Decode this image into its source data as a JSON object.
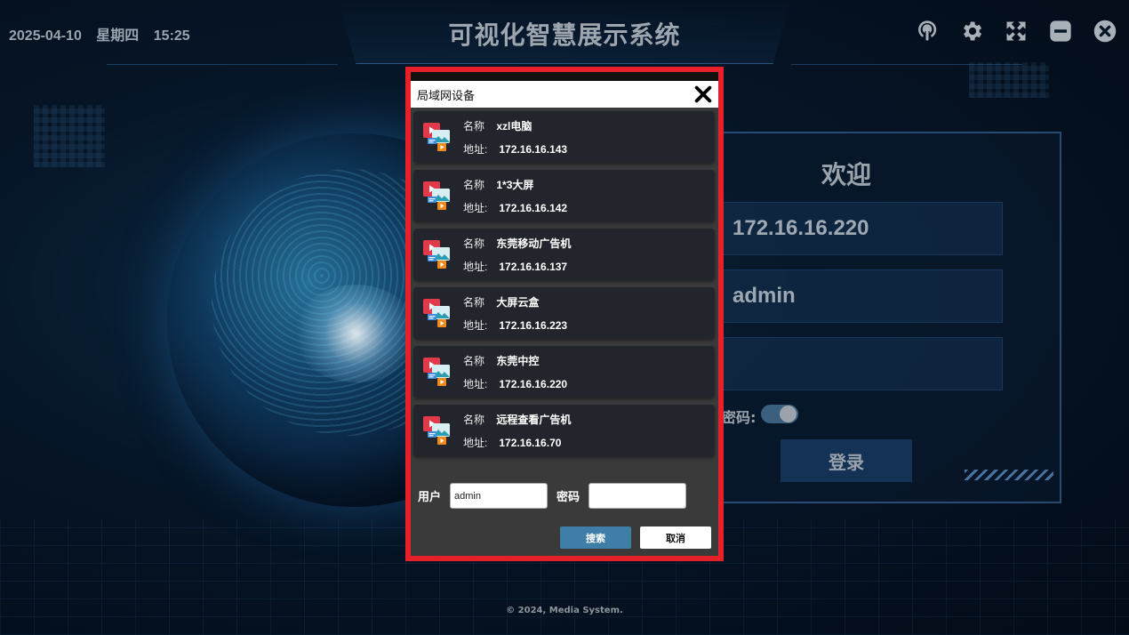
{
  "header": {
    "date": "2025-04-10",
    "weekday": "星期四",
    "time": "15:25",
    "title": "可视化智慧展示系统"
  },
  "icons": [
    "podcast-icon",
    "gear-icon",
    "fullscreen-icon",
    "minimize-icon",
    "close-icon"
  ],
  "login": {
    "title": "欢迎",
    "server_value": "172.16.16.220",
    "username_value": "admin",
    "password_value": "",
    "remember_label": "密码:",
    "login_button": "登录"
  },
  "dialog": {
    "title": "局域网设备",
    "name_key": "名称",
    "addr_key": "地址:",
    "devices": [
      {
        "name": "xzl电脑",
        "address": "172.16.16.143"
      },
      {
        "name": "1*3大屏",
        "address": "172.16.16.142"
      },
      {
        "name": "东莞移动广告机",
        "address": "172.16.16.137"
      },
      {
        "name": "大屏云盒",
        "address": "172.16.16.223"
      },
      {
        "name": "东莞中控",
        "address": "172.16.16.220"
      },
      {
        "name": "远程查看广告机",
        "address": "172.16.16.70"
      }
    ],
    "user_label": "用户",
    "user_value": "admin",
    "password_label": "密码",
    "password_value": "",
    "search_button": "搜索",
    "cancel_button": "取消"
  },
  "footer": {
    "copyright": "© 2024, Media System."
  },
  "colors": {
    "dialog_border": "#e8202a",
    "search_button": "#3f7ea6",
    "device_bg": "#23252c"
  }
}
